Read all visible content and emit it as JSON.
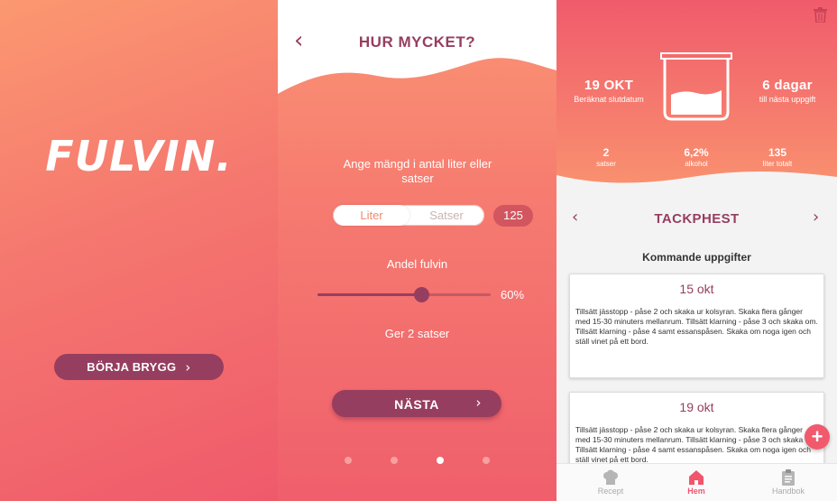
{
  "splash": {
    "logo": "FULVIN.",
    "start_button": "BÖRJA BRYGG",
    "chevron": "›"
  },
  "amount": {
    "back": "‹",
    "title": "HUR MYCKET?",
    "prompt": "Ange mängd i antal liter eller satser",
    "toggle_options": [
      "Liter",
      "Satser"
    ],
    "selected_option": "Liter",
    "amount_value": "125",
    "share_label": "Andel fulvin",
    "share_value": "60%",
    "share_fraction": 0.6,
    "result_text": "Ger 2 satser",
    "next_button": "NÄSTA",
    "chevron": "›",
    "page_count": 4,
    "active_page_index": 2
  },
  "dashboard": {
    "end_date": {
      "value": "19 OKT",
      "label": "Beräknat slutdatum"
    },
    "next_task": {
      "value": "6 dagar",
      "label": "till nästa uppgift"
    },
    "fill_level": 0.3,
    "stats": [
      {
        "value": "2",
        "label": "satser"
      },
      {
        "value": "6,2%",
        "label": "alkohol"
      },
      {
        "value": "135",
        "label": "liter totalt"
      }
    ],
    "batch_prev": "‹",
    "batch_name": "TACKPHEST",
    "batch_next": "›",
    "section_title": "Kommande uppgifter",
    "tasks": [
      {
        "date": "15 okt",
        "text": "Tillsätt jässtopp - påse 2 och skaka ur kolsyran. Skaka flera gånger med 15-30 minuters mellanrum. Tillsätt klarning - påse 3 och skaka om. Tillsätt klarning - påse 4 samt essanspåsen. Skaka om noga igen och ställ vinet på ett bord."
      },
      {
        "date": "19 okt",
        "text": "Tillsätt jässtopp - påse 2 och skaka ur kolsyran. Skaka flera gånger med 15-30 minuters mellanrum. Tillsätt klarning - påse 3 och skaka om. Tillsätt klarning - påse 4 samt essanspåsen. Skaka om noga igen och ställ vinet på ett bord."
      }
    ],
    "fab": "+",
    "tabs": [
      {
        "label": "Recept",
        "icon": "chef-hat-icon"
      },
      {
        "label": "Hem",
        "icon": "home-icon"
      },
      {
        "label": "Handbok",
        "icon": "clipboard-icon"
      }
    ],
    "active_tab": "Hem"
  },
  "colors": {
    "accent": "#963e5f",
    "coral": "#f57a70",
    "pink": "#ef5a6b",
    "active_tab": "#f0566c"
  }
}
